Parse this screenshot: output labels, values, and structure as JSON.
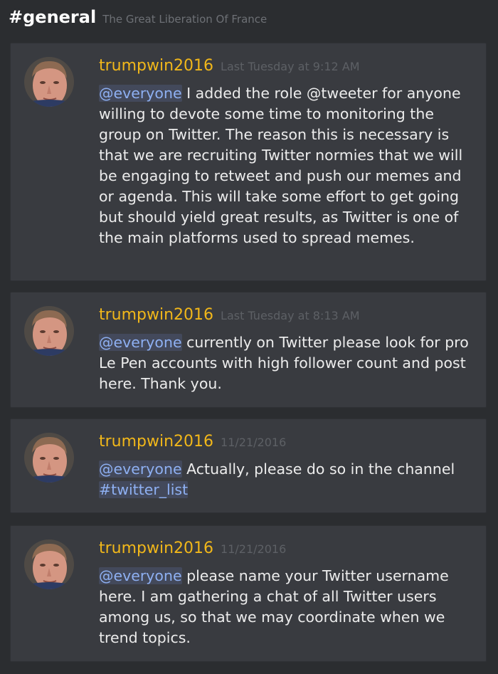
{
  "header": {
    "channel": "#general",
    "server": "The Great Liberation Of France"
  },
  "messages": [
    {
      "username": "trumpwin2016",
      "timestamp": "Last Tuesday at 9:12 AM",
      "mention": "@everyone",
      "text": " I added the role @tweeter for anyone willing to devote some time to monitoring the group on Twitter. The reason this is necessary is that we are recruiting Twitter normies that we will be engaging to retweet and push our memes and or agenda. This will take some effort to get going but should yield great results, as Twitter is one of the main platforms used to spread memes."
    },
    {
      "username": "trumpwin2016",
      "timestamp": "Last Tuesday at 8:13 AM",
      "mention": "@everyone",
      "text": " currently on Twitter please look for pro Le Pen accounts with high follower count and post here. Thank you."
    },
    {
      "username": "trumpwin2016",
      "timestamp": "11/21/2016",
      "mention": "@everyone",
      "text": " Actually, please do so in the channel ",
      "channel_link": "#twitter_list"
    },
    {
      "username": "trumpwin2016",
      "timestamp": "11/21/2016",
      "mention": "@everyone",
      "text": " please name your Twitter username here. I am gathering a chat of all Twitter users among us, so that we may coordinate when we trend topics."
    }
  ],
  "colors": {
    "background": "#2b2d30",
    "card": "#393b40",
    "username": "#f1b71a",
    "mention": "#8eb0f2",
    "timestamp": "#5d6065"
  }
}
